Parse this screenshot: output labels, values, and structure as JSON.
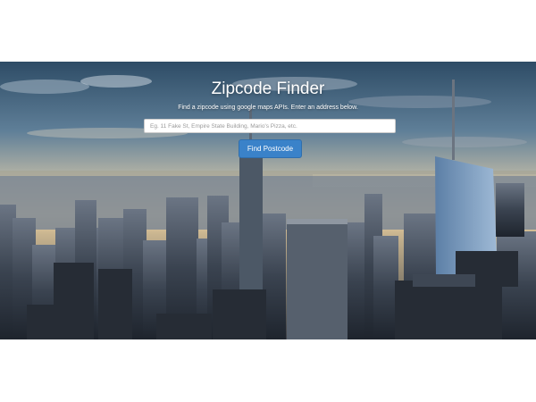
{
  "header": {
    "title": "Zipcode Finder",
    "subtitle": "Find a zipcode using google maps APIs. Enter an address below."
  },
  "search": {
    "placeholder": "Eg. 11 Fake St, Empire State Building, Mario's Pizza, etc.",
    "value": ""
  },
  "actions": {
    "find_label": "Find Postcode"
  },
  "colors": {
    "button": "#3a82c9",
    "sky_top": "#2e4c66",
    "sky_horizon": "#f3d9a8",
    "city": "#2b3340"
  }
}
